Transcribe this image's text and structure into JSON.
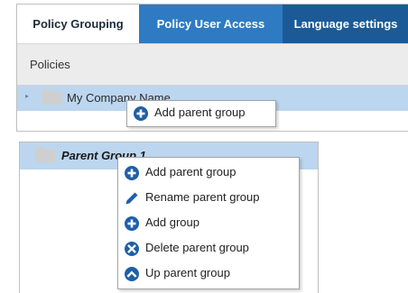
{
  "tabs": [
    {
      "label": "Policy Grouping",
      "active": true
    },
    {
      "label": "Policy User Access",
      "active": false
    },
    {
      "label": "Language settings",
      "active": false
    }
  ],
  "tree_header": {
    "label": "Policies"
  },
  "tree1": {
    "node_label": "My Company Name"
  },
  "context_menu_1": {
    "items": [
      {
        "label": "Add parent group",
        "icon": "plus-circle-icon"
      }
    ]
  },
  "tree2": {
    "node_label": "Parent Group 1"
  },
  "context_menu_2": {
    "items": [
      {
        "label": "Add parent group",
        "icon": "plus-circle-icon"
      },
      {
        "label": "Rename parent group",
        "icon": "pencil-icon"
      },
      {
        "label": "Add group",
        "icon": "plus-circle-icon"
      },
      {
        "label": "Delete parent group",
        "icon": "x-circle-icon"
      },
      {
        "label": "Up parent group",
        "icon": "chevron-up-circle-icon"
      }
    ]
  },
  "colors": {
    "tab_bar": "#1b4f87",
    "tab_hover": "#2e7bc3",
    "selected_row": "#bcd6ef",
    "icon_blue": "#1f5fa8"
  }
}
